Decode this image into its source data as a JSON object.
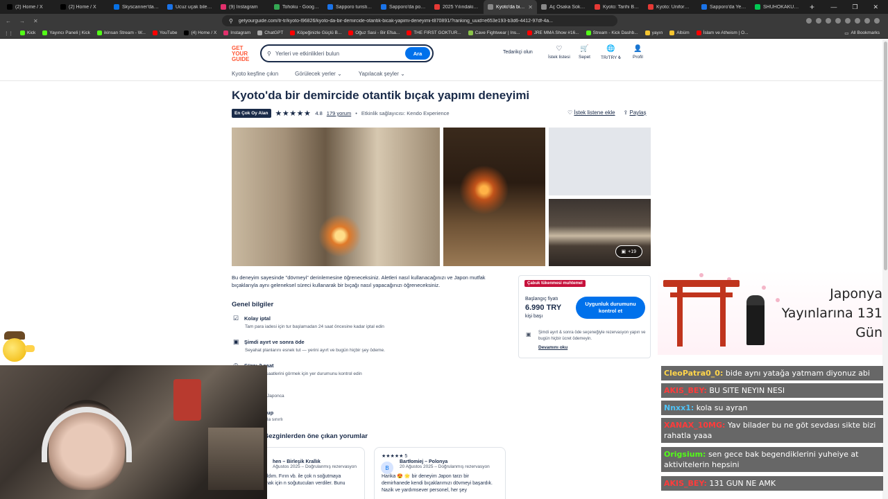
{
  "browser": {
    "tabs": [
      {
        "label": "(2) Home / X",
        "color": "#000000"
      },
      {
        "label": "(2) Home / X",
        "color": "#000000"
      },
      {
        "label": "Skyscanner'da Okin",
        "color": "#0770e3"
      },
      {
        "label": "Ucuz uçak bileti en",
        "color": "#1a73e8"
      },
      {
        "label": "(9) Instagram",
        "color": "#e1306c"
      },
      {
        "label": "Tohoku - Google M",
        "color": "#34a853"
      },
      {
        "label": "Sapporo turistik ne",
        "color": "#1a73e8"
      },
      {
        "label": "Sapporo'da popüle",
        "color": "#1a73e8"
      },
      {
        "label": "2025 Yılındaki EN P",
        "color": "#e53935"
      },
      {
        "label": "Kyoto'da bir de",
        "color": "#888888",
        "active": true
      },
      {
        "label": "Aç Osaka Sokak Ye",
        "color": "#888888"
      },
      {
        "label": "Kyoto: Tarihi Bir Ko",
        "color": "#e53935"
      },
      {
        "label": "Kyoto: Üniforma ve",
        "color": "#e53935"
      },
      {
        "label": "Sapporo'da Yerel B",
        "color": "#1a73e8"
      },
      {
        "label": "SHUHOKAKU KOGE",
        "color": "#00c853"
      }
    ],
    "url": "getyourguide.com/tr-tr/kyoto-l96826/kyoto-da-bir-demircide-otantik-bicak-yapimi-deneyimi-t870891/?ranking_uuid=e653e193-b3d6-4412-97df-4a...",
    "bookmarks": [
      {
        "label": "Kick",
        "color": "#53fc18"
      },
      {
        "label": "Yayıncı Paneli | Kick",
        "color": "#53fc18"
      },
      {
        "label": "ikinsan Stream - W...",
        "color": "#53fc18"
      },
      {
        "label": "YouTube",
        "color": "#ff0000"
      },
      {
        "label": "(4) Home / X",
        "color": "#000000"
      },
      {
        "label": "Instagram",
        "color": "#e1306c"
      },
      {
        "label": "ChatGPT",
        "color": "#aaaaaa"
      },
      {
        "label": "Köpeğinizle Güçlü B...",
        "color": "#ff0000"
      },
      {
        "label": "Oğuz Sasi - Bir Efsa...",
        "color": "#ff0000"
      },
      {
        "label": "THE FIRST GOKTUR...",
        "color": "#ff0000"
      },
      {
        "label": "Cave Fightwear | Ins...",
        "color": "#8bc34a"
      },
      {
        "label": "JRE MMA Show #16...",
        "color": "#ff0000"
      },
      {
        "label": "Stream - Kick Dashb...",
        "color": "#53fc18"
      },
      {
        "label": "yayın",
        "color": "#f4c430"
      },
      {
        "label": "Albüm",
        "color": "#f4c430"
      },
      {
        "label": "İslam ve Atheism | O...",
        "color": "#ff0000"
      }
    ],
    "all_bookmarks": "All Bookmarks"
  },
  "site": {
    "logo_lines": [
      "GET",
      "YOUR",
      "GUIDE"
    ],
    "search_placeholder": "Yerleri ve etkinlikleri bulun",
    "search_button": "Ara",
    "supplier_link": "Tedarikçi olun",
    "header_items": [
      {
        "icon": "heart-icon",
        "glyph": "♡",
        "label": "İstek listesi"
      },
      {
        "icon": "cart-icon",
        "glyph": "🛒",
        "label": "Sepet"
      },
      {
        "icon": "globe-icon",
        "glyph": "🌐",
        "label": "TR/TRY ₺"
      },
      {
        "icon": "user-icon",
        "glyph": "👤",
        "label": "Profil"
      }
    ],
    "subnav": [
      {
        "label": "Kyoto keşfine çıkın",
        "dropdown": false
      },
      {
        "label": "Görülecek yerler",
        "dropdown": true
      },
      {
        "label": "Yapılacak şeyler",
        "dropdown": true
      }
    ]
  },
  "activity": {
    "title": "Kyoto'da bir demircide otantik bıçak yapımı deneyimi",
    "badge": "En Çok Oy Alan",
    "stars": "★★★★★",
    "rating": "4.8",
    "reviews": "179 yorum",
    "provider": "Etkinlik sağlayıcısı: Kendo Experience",
    "wishlist_action": "İstek listene ekle",
    "share_action": "Paylaş",
    "more_photos": "+19",
    "description": "Bu deneyim sayesinde \"dövmeyi\" derinlemesine öğreneceksiniz. Aletleri nasıl kullanacağınızı ve Japon mutfak bıçaklarıyla aynı geleneksel süreci kullanarak bir bıçağı nasıl yapacağınızı öğreneceksiniz.",
    "general_info_heading": "Genel bilgiler",
    "info": [
      {
        "icon": "calendar-check-icon",
        "glyph": "☑",
        "title": "Kolay iptal",
        "sub": "Tam para iadesi için tur başlamadan 24 saat öncesine kadar iptal edin"
      },
      {
        "icon": "wallet-icon",
        "glyph": "▣",
        "title": "Şimdi ayırt ve sonra öde",
        "sub": "Seyahat planlarını esnek tut — yerini ayırt ve bugün hiçbir şey ödeme."
      },
      {
        "icon": "clock-icon",
        "glyph": "◷",
        "title": "Süre: 2 saat",
        "sub": "Başlangıç saatlerini görmek için yer durumunu kontrol edin"
      }
    ],
    "info_fragments": [
      {
        "text": "Japonca",
        "title": false
      },
      {
        "text": "up",
        "title": true
      },
      {
        "text": "la sınırlı",
        "title": false
      }
    ],
    "reviews_heading": "Gezginlerden öne çıkan yorumlar",
    "review_cards": [
      {
        "stars": "",
        "name": "hen – Birleşik Krallık",
        "date": "Ağustos 2025 – Doğrulanmış rezervasyon",
        "avatar": "",
        "text": "nden keyif aldım. Fırın vb. ile çok n soğutmaya yardımcı olmak için n soğutucuları verdiler. Bunu taysiye"
      },
      {
        "stars": "★★★★★ 5",
        "name": "Bartłomiej – Polonya",
        "date": "20 Ağustos 2025 – Doğrulanmış rezervasyon",
        "avatar": "B",
        "text": "Harika 😍 🌟 bir deneyim Japon tarzı bir demirhanede kendi bıçaklarımızı dövmeyi başardık. Nazik ve yardımsever personel, her şey"
      }
    ]
  },
  "booking": {
    "badge": "Çabuk tükenmesi muhtemel",
    "from_label": "Başlangıç fiyatı",
    "price": "6.990 TRY",
    "per": "kişi başı",
    "button": "Uygunluk durumunu kontrol et",
    "note": "Şimdi ayırt & sonra öde seçeneğiyle rezervasyon yapın ve bugün hiçbir ücret ödemeyin.",
    "more": "Devamını oku"
  },
  "stream": {
    "banner_lines": [
      "Japonya",
      "Yayınlarına 131",
      "Gün"
    ],
    "chat": [
      {
        "user": "CleoPatra0_0:",
        "user_color": "#ffd54a",
        "text": "bide aynı yatağa yatmam diyonuz abi"
      },
      {
        "user": "AKIS_BEY:",
        "user_color": "#ff3b3b",
        "text": "BU SITE NEYIN NESI"
      },
      {
        "user": "Nnxx1:",
        "user_color": "#4fc3f7",
        "text": "kola su ayran"
      },
      {
        "user": "XANAX_10MG:",
        "user_color": "#ff3b3b",
        "text": "Yav bilader bu ne göt sevdası sikte bizi rahatla yaaa"
      },
      {
        "user": "Origsium:",
        "user_color": "#53fc18",
        "text": "sen gece bak begendiklerini yuheiye at aktivitelerin hepsini"
      },
      {
        "user": "AKIS_BEY:",
        "user_color": "#ff3b3b",
        "text": "131 GUN NE AMK"
      }
    ]
  }
}
